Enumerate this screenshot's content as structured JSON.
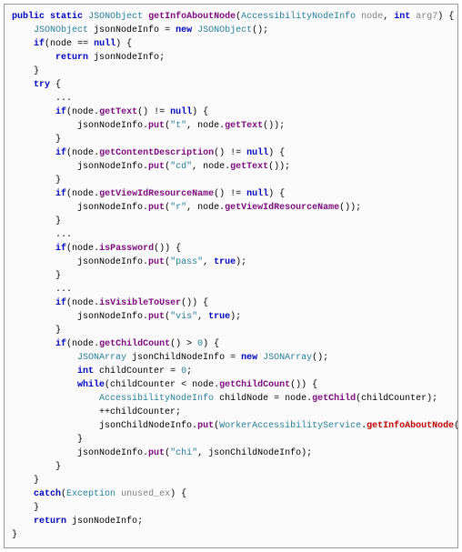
{
  "code": {
    "colors": {
      "keyword": "#0000c0",
      "type": "#267f99",
      "method": "#7c0a7c",
      "param": "#808080",
      "string": "#267f99",
      "key": "#c00000"
    },
    "tokens": {
      "kw_public": "public",
      "kw_static": "static",
      "kw_new": "new",
      "kw_if": "if",
      "kw_return": "return",
      "kw_try": "try",
      "kw_catch": "catch",
      "kw_null": "null",
      "kw_int": "int",
      "kw_while": "while",
      "kw_true": "true",
      "type_JSONObject": "JSONObject",
      "type_JSONArray": "JSONArray",
      "type_AccessibilityNodeInfo": "AccessibilityNodeInfo",
      "type_Exception": "Exception",
      "type_WorkerAccessibilityService": "WorkerAccessibilityService",
      "method_getInfoAboutNode": "getInfoAboutNode",
      "method_getText": "getText",
      "method_put": "put",
      "method_getContentDescription": "getContentDescription",
      "method_getViewIdResourceName": "getViewIdResourceName",
      "method_isPassword": "isPassword",
      "method_isVisibleToUser": "isVisibleToUser",
      "method_getChildCount": "getChildCount",
      "method_getChild": "getChild",
      "var_node": "node",
      "var_arg7": "arg7",
      "var_jsonNodeInfo": "jsonNodeInfo",
      "var_jsonChildNodeInfo": "jsonChildNodeInfo",
      "var_childCounter": "childCounter",
      "var_childNode": "childNode",
      "var_unused_ex": "unused_ex",
      "str_t": "\"t\"",
      "str_cd": "\"cd\"",
      "str_r": "\"r\"",
      "str_pass": "\"pass\"",
      "str_vis": "\"vis\"",
      "str_chi": "\"chi\"",
      "num_0": "0",
      "ellipsis": "...",
      "brace_open": "{",
      "brace_close": "}",
      "paren_open": "(",
      "paren_close": ")",
      "semi": ";",
      "comma": ",",
      "eq": "=",
      "eqeq": "==",
      "neq": "!=",
      "gt": ">",
      "lt": "<",
      "dot": ".",
      "plusplus": "++",
      "sp": " "
    }
  }
}
